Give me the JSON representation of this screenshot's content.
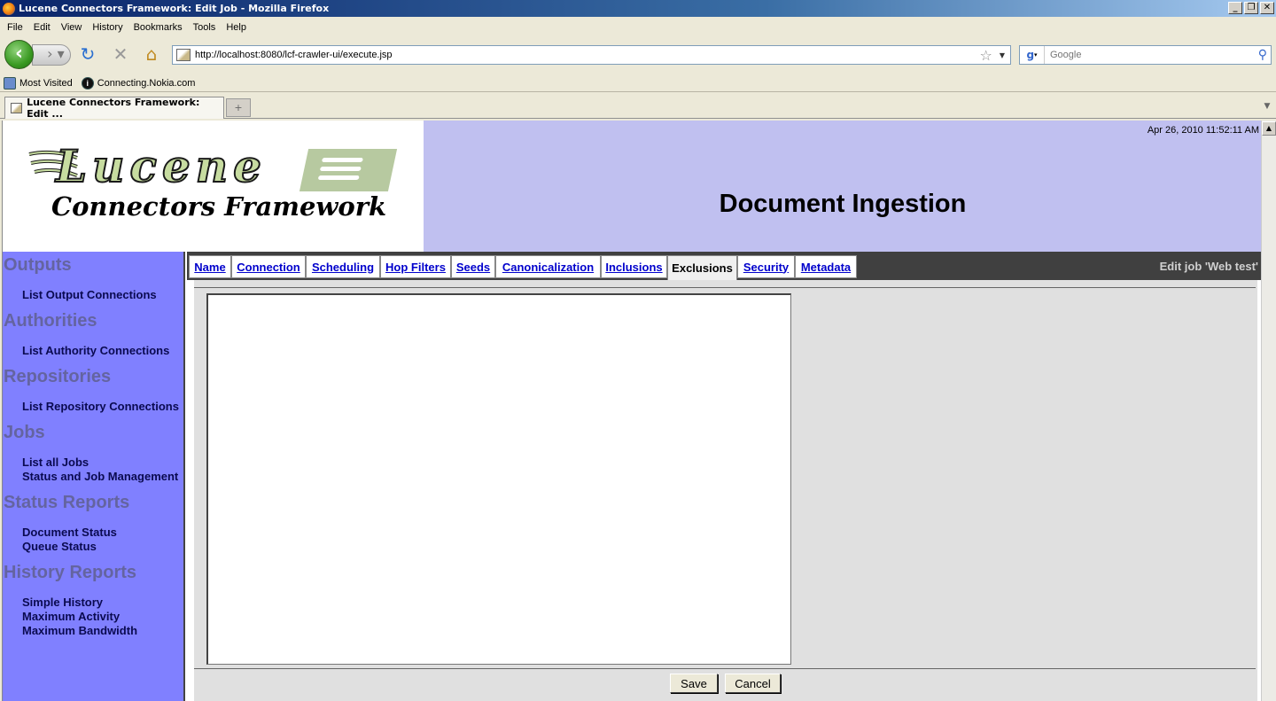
{
  "window": {
    "title": "Lucene Connectors Framework: Edit Job - Mozilla Firefox",
    "controls": [
      "_",
      "❐",
      "✕"
    ]
  },
  "menu": [
    "File",
    "Edit",
    "View",
    "History",
    "Bookmarks",
    "Tools",
    "Help"
  ],
  "navigation": {
    "url": "http://localhost:8080/lcf-crawler-ui/execute.jsp",
    "search_placeholder": "Google"
  },
  "bookmarks": [
    "Most Visited",
    "Connecting.Nokia.com"
  ],
  "browser_tab": {
    "title": "Lucene Connectors Framework: Edit ...",
    "new_tab": "+"
  },
  "header": {
    "logo_title": "Lucene",
    "logo_subtitle": "Connectors Framework",
    "timestamp": "Apr 26, 2010 11:52:11 AM",
    "page_heading": "Document Ingestion"
  },
  "sidebar": {
    "sections": [
      {
        "title": "Outputs",
        "links": [
          "List Output Connections"
        ]
      },
      {
        "title": "Authorities",
        "links": [
          "List Authority Connections"
        ]
      },
      {
        "title": "Repositories",
        "links": [
          "List Repository Connections"
        ]
      },
      {
        "title": "Jobs",
        "links": [
          "List all Jobs",
          "Status and Job Management"
        ]
      },
      {
        "title": "Status Reports",
        "links": [
          "Document Status",
          "Queue Status"
        ]
      },
      {
        "title": "History Reports",
        "links": [
          "Simple History",
          "Maximum Activity",
          "Maximum Bandwidth"
        ]
      }
    ]
  },
  "job_tabs": [
    {
      "label": "Name",
      "active": false
    },
    {
      "label": "Connection",
      "active": false
    },
    {
      "label": "Scheduling",
      "active": false
    },
    {
      "label": "Hop Filters",
      "active": false
    },
    {
      "label": "Seeds",
      "active": false
    },
    {
      "label": "Canonicalization",
      "active": false
    },
    {
      "label": "Inclusions",
      "active": false
    },
    {
      "label": "Exclusions",
      "active": true
    },
    {
      "label": "Security",
      "active": false
    },
    {
      "label": "Metadata",
      "active": false
    }
  ],
  "edit_job_label": "Edit job 'Web test'",
  "form": {
    "exclusions_value": "",
    "save_label": "Save",
    "cancel_label": "Cancel"
  },
  "colors": {
    "header_bg": "#c0c0f0",
    "sidebar_bg": "#8080ff",
    "link": "#0000cc"
  }
}
